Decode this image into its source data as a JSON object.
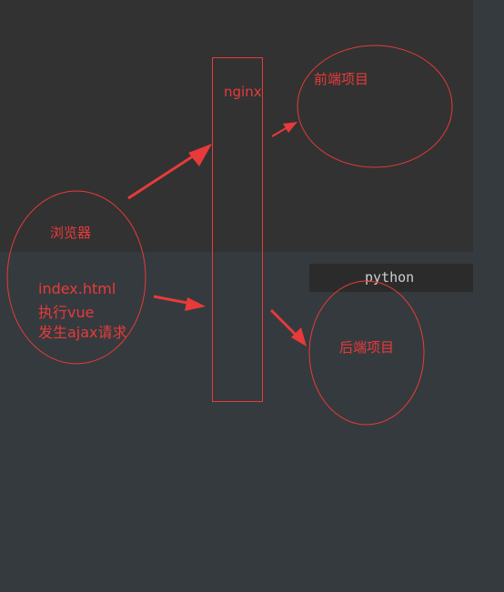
{
  "nodes": {
    "browser": {
      "title": "浏览器",
      "lines": [
        "index.html",
        "执行vue",
        "发生ajax请求"
      ]
    },
    "nginx": {
      "label": "nginx"
    },
    "frontend": {
      "label": "前端项目"
    },
    "backend": {
      "label": "后端项目"
    },
    "python_bar": {
      "label": "python"
    }
  },
  "colors": {
    "canvas_bg": "#353a3e",
    "top_panel_bg": "#323232",
    "python_bar_bg": "#2b2b2b",
    "stroke": "#e83a3a",
    "python_text": "#cfcfcf"
  },
  "arrows": [
    {
      "from": "browser",
      "to": "nginx",
      "icon": "arrow-right-up-icon"
    },
    {
      "from": "browser",
      "to": "nginx",
      "icon": "arrow-right-icon"
    },
    {
      "from": "nginx",
      "to": "frontend",
      "icon": "arrow-right-up-icon"
    },
    {
      "from": "nginx",
      "to": "backend",
      "icon": "arrow-right-down-icon"
    }
  ]
}
